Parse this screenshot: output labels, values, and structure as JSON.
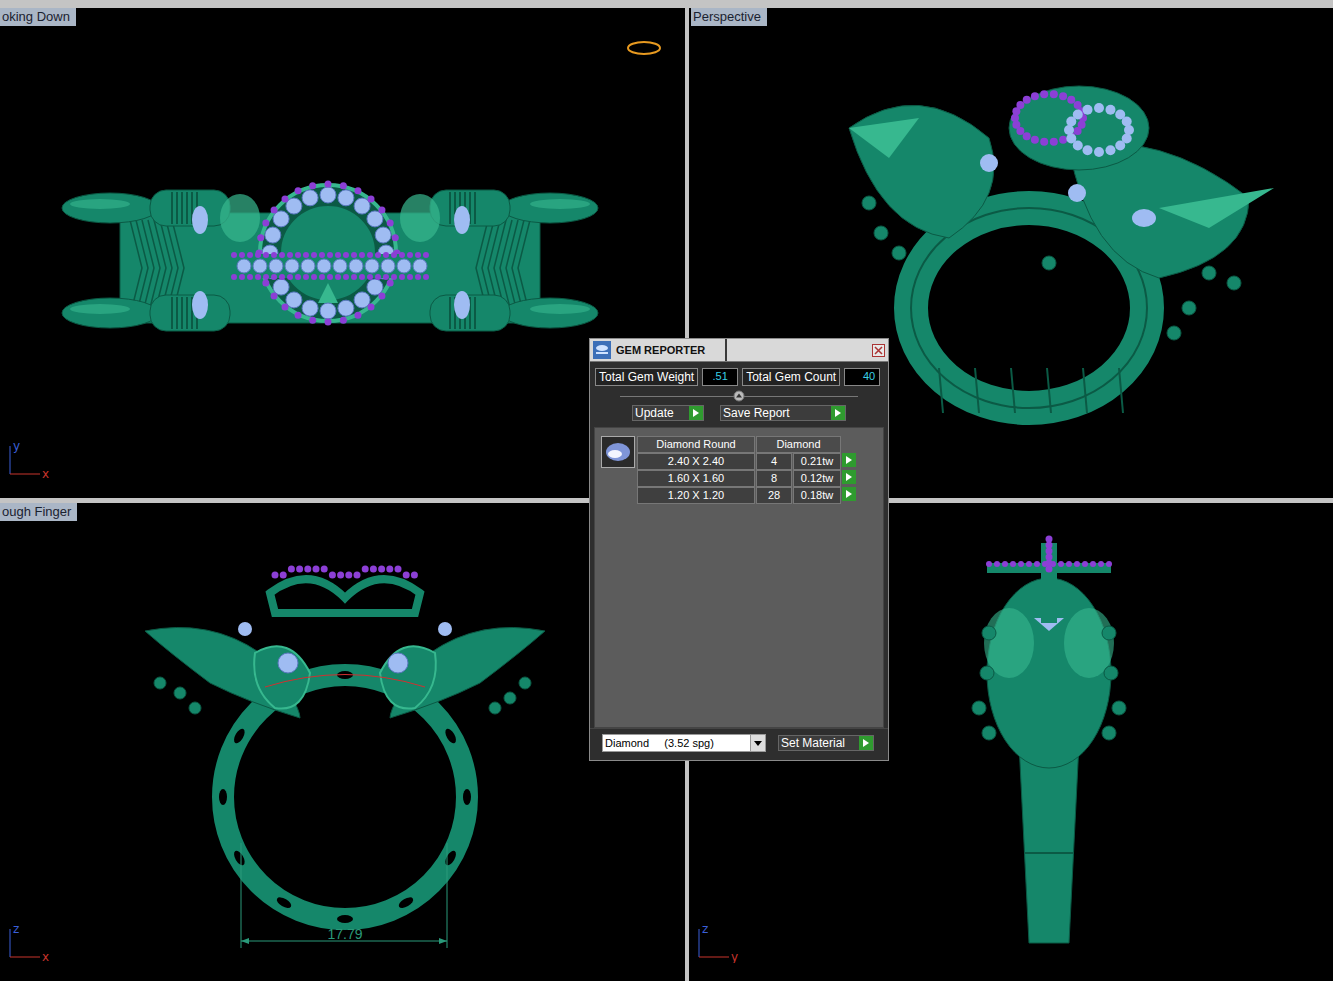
{
  "viewports": [
    {
      "label": "oking Down",
      "view": "top",
      "axes": [
        "y",
        "x"
      ]
    },
    {
      "label": "Perspective",
      "view": "perspective",
      "axes": []
    },
    {
      "label": "ough Finger",
      "view": "front",
      "axes": [
        "z",
        "x"
      ],
      "dimension": "17.79"
    },
    {
      "view": "side",
      "axes": [
        "z",
        "y"
      ]
    }
  ],
  "gem_reporter": {
    "title": "GEM REPORTER",
    "total_weight_label": "Total Gem Weight",
    "total_weight": ".51",
    "total_count_label": "Total Gem Count",
    "total_count": "40",
    "buttons": [
      "Update",
      "Save Report"
    ],
    "columns": [
      "Diamond Round",
      "Diamond"
    ],
    "rows": [
      {
        "size": "2.40 X 2.40",
        "count": "4",
        "weight": "0.21tw"
      },
      {
        "size": "1.60 X 1.60",
        "count": "8",
        "weight": "0.12tw"
      },
      {
        "size": "1.20 X 1.20",
        "count": "28",
        "weight": "0.18tw"
      }
    ],
    "material": "Diamond     (3.52 spg)",
    "set_material": "Set Material"
  }
}
